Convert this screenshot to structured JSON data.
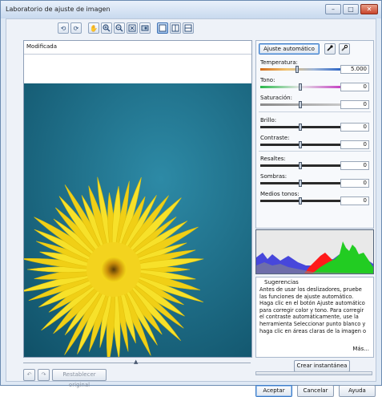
{
  "window": {
    "title": "Laboratorio de ajuste de imagen",
    "controls": [
      "minimize",
      "maximize",
      "close"
    ]
  },
  "toolbar": {
    "buttons": [
      {
        "name": "rotate-left-icon"
      },
      {
        "name": "rotate-right-icon"
      },
      {
        "name": "hand-icon"
      },
      {
        "name": "zoom-in-icon"
      },
      {
        "name": "zoom-out-icon"
      },
      {
        "name": "fit-to-window-icon"
      },
      {
        "name": "actual-size-icon"
      },
      {
        "name": "single-view-icon",
        "active": true
      },
      {
        "name": "split-vertical-icon"
      },
      {
        "name": "split-horizontal-icon"
      }
    ]
  },
  "preview": {
    "label": "Modificada"
  },
  "controls_panel": {
    "auto_button": "Ajuste automático",
    "sliders": [
      {
        "id": "temperatura",
        "label": "Temperatura:",
        "value": "5.000",
        "level": 0.46,
        "track": "temperature"
      },
      {
        "id": "tono",
        "label": "Tono:",
        "value": "0",
        "level": 0.5,
        "track": "tint"
      },
      {
        "id": "saturacion",
        "label": "Saturación:",
        "value": "0",
        "level": 0.5,
        "track": "saturation"
      },
      {
        "id": "brillo",
        "label": "Brillo:",
        "value": "0",
        "level": 0.5,
        "track": "dark"
      },
      {
        "id": "contraste",
        "label": "Contraste:",
        "value": "0",
        "level": 0.5,
        "track": "dark"
      },
      {
        "id": "resaltes",
        "label": "Resaltes:",
        "value": "0",
        "level": 0.5,
        "track": "dark"
      },
      {
        "id": "sombras",
        "label": "Sombras:",
        "value": "0",
        "level": 0.5,
        "track": "dark"
      },
      {
        "id": "medios",
        "label": "Medios tonos:",
        "value": "0",
        "level": 0.5,
        "track": "dark"
      }
    ]
  },
  "tips": {
    "title": "Sugerencias",
    "text": "Antes de usar los deslizadores, pruebe las funciones de ajuste automático. Haga clic en el botón Ajuste automático para corregir color y tono. Para corregir el contraste automáticamente, use la herramienta Seleccionar punto blanco y haga clic en áreas claras de la imagen o",
    "more": "Más..."
  },
  "buttons": {
    "snapshot": "Crear instantánea",
    "reset": "Restablecer original",
    "accept": "Aceptar",
    "cancel": "Cancelar",
    "help": "Ayuda"
  },
  "colors": {
    "histogram_red": "#ff1a1a",
    "histogram_green": "#22cc22",
    "histogram_blue": "#2a2ad8",
    "flower_yellow": "#f5d91a",
    "background_teal": "#1a6d8a"
  }
}
